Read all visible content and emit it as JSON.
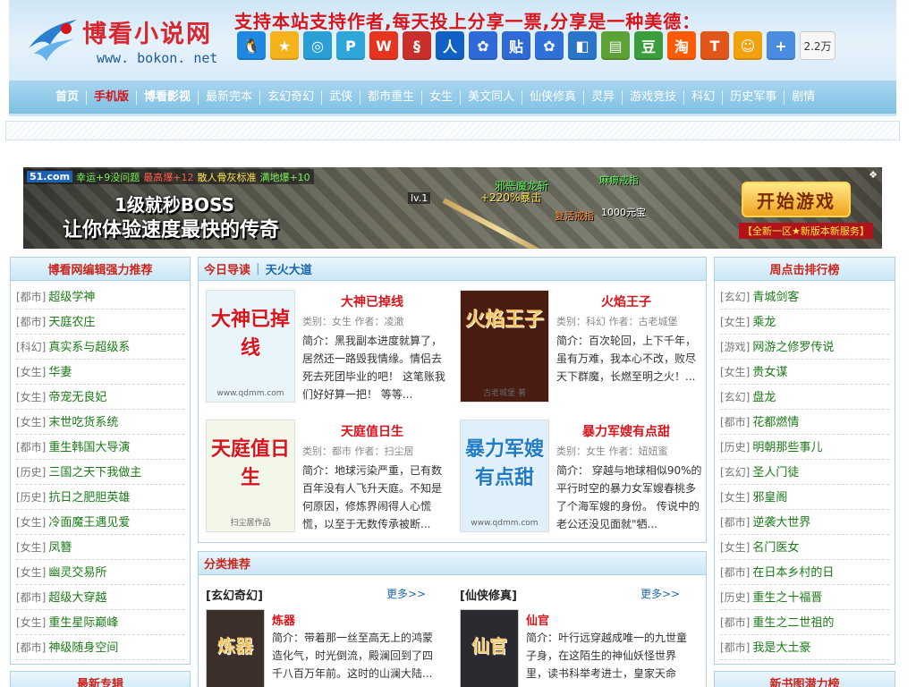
{
  "header": {
    "logo_title": "博看小说网",
    "logo_url": "www. bokon. net",
    "slogan": "支持本站支持作者,每天投上分享一票,分享是一种美德：",
    "share_count": "2.2万",
    "share_icons": [
      {
        "name": "qq",
        "glyph": "🐧",
        "color": "#1e88e5"
      },
      {
        "name": "qzone",
        "glyph": "★",
        "color": "#f6b21b"
      },
      {
        "name": "pengyou",
        "glyph": "◎",
        "color": "#2a9fd6"
      },
      {
        "name": "tencent-weibo",
        "glyph": "P",
        "color": "#2fa6d9"
      },
      {
        "name": "sina-weibo",
        "glyph": "W",
        "color": "#e8331f"
      },
      {
        "name": "netease",
        "glyph": "§",
        "color": "#c9302c"
      },
      {
        "name": "renren",
        "glyph": "人",
        "color": "#1160c4"
      },
      {
        "name": "baidu",
        "glyph": "✿",
        "color": "#2f6ad8"
      },
      {
        "name": "tieba",
        "glyph": "贴",
        "color": "#2f6ad8"
      },
      {
        "name": "baidu-paw",
        "glyph": "✿",
        "color": "#3070d8"
      },
      {
        "name": "kaixin",
        "glyph": "◧",
        "color": "#2a75c9"
      },
      {
        "name": "android",
        "glyph": "▤",
        "color": "#5da236"
      },
      {
        "name": "douban",
        "glyph": "豆",
        "color": "#3c9d3c"
      },
      {
        "name": "taobao",
        "glyph": "淘",
        "color": "#ff5a00"
      },
      {
        "name": "tianya",
        "glyph": "T",
        "color": "#e2561a"
      },
      {
        "name": "favorite",
        "glyph": "☺",
        "color": "#f2a20c"
      },
      {
        "name": "more",
        "glyph": "+",
        "color": "#4a8de0"
      }
    ]
  },
  "nav": [
    {
      "label": "首页",
      "style": "bold"
    },
    {
      "label": "手机版",
      "style": "red"
    },
    {
      "label": "博看影视",
      "style": "bold"
    },
    {
      "label": "最新完本",
      "style": ""
    },
    {
      "label": "玄幻奇幻",
      "style": ""
    },
    {
      "label": "武侠",
      "style": ""
    },
    {
      "label": "都市重生",
      "style": ""
    },
    {
      "label": "女生",
      "style": ""
    },
    {
      "label": "美文同人",
      "style": ""
    },
    {
      "label": "仙侠修真",
      "style": ""
    },
    {
      "label": "灵异",
      "style": ""
    },
    {
      "label": "游戏竞技",
      "style": ""
    },
    {
      "label": "科幻",
      "style": ""
    },
    {
      "label": "历史军事",
      "style": ""
    },
    {
      "label": "剧情",
      "style": ""
    }
  ],
  "banner": {
    "badge": "51.com",
    "topline": [
      "幸运+9没问题",
      "最高爆+12",
      "散人骨灰标准",
      "满地爆+10"
    ],
    "line1": "1级就秒BOSS",
    "line2": "让你体验速度最快的传奇",
    "level": "lv.1",
    "drop1": "邪恶魔龙斩",
    "drop2": "+220%暴击",
    "drop3": "麻痹戒指",
    "drop4": "复活戒指",
    "drop5": "1000元宝",
    "cta": "开始游戏",
    "sub": "【全新一区★新版本新服务】"
  },
  "left": {
    "title": "博看网编辑强力推荐",
    "items": [
      {
        "tag": "[都市]",
        "title": "超级学神"
      },
      {
        "tag": "[都市]",
        "title": "天庭农庄"
      },
      {
        "tag": "[科幻]",
        "title": "真实系与超级系"
      },
      {
        "tag": "[女生]",
        "title": "华妻"
      },
      {
        "tag": "[女生]",
        "title": "帝宠无良妃"
      },
      {
        "tag": "[女生]",
        "title": "末世吃货系统"
      },
      {
        "tag": "[都市]",
        "title": "重生韩国大导演"
      },
      {
        "tag": "[历史]",
        "title": "三国之天下我做主"
      },
      {
        "tag": "[历史]",
        "title": "抗日之肥胆英雄"
      },
      {
        "tag": "[女生]",
        "title": "冷面魔王遇见爱"
      },
      {
        "tag": "[女生]",
        "title": "凤簪"
      },
      {
        "tag": "[女生]",
        "title": "幽灵交易所"
      },
      {
        "tag": "[都市]",
        "title": "超级大穿越"
      },
      {
        "tag": "[女生]",
        "title": "重生星际巅峰"
      },
      {
        "tag": "[都市]",
        "title": "神级随身空间"
      }
    ],
    "next_title": "最新专辑"
  },
  "right": {
    "title": "周点击排行榜",
    "items": [
      {
        "tag": "[玄幻]",
        "title": "青城剑客"
      },
      {
        "tag": "[女生]",
        "title": "乘龙"
      },
      {
        "tag": "[游戏]",
        "title": "网游之修罗传说"
      },
      {
        "tag": "[女生]",
        "title": "贵女谋"
      },
      {
        "tag": "[玄幻]",
        "title": "盘龙"
      },
      {
        "tag": "[都市]",
        "title": "花都燃情"
      },
      {
        "tag": "[历史]",
        "title": "明朝那些事儿"
      },
      {
        "tag": "[玄幻]",
        "title": "圣人门徒"
      },
      {
        "tag": "[女生]",
        "title": "邪皇阁"
      },
      {
        "tag": "[都市]",
        "title": "逆袭大世界"
      },
      {
        "tag": "[女生]",
        "title": "名门医女"
      },
      {
        "tag": "[都市]",
        "title": "在日本乡村的日"
      },
      {
        "tag": "[历史]",
        "title": "重生之十福晋"
      },
      {
        "tag": "[都市]",
        "title": "重生之二世祖的"
      },
      {
        "tag": "[都市]",
        "title": "我是大土豪"
      }
    ],
    "next_title": "新书图潜力榜"
  },
  "today": {
    "tab1": "今日导读",
    "sep": "|",
    "tab2": "天火大道",
    "books": [
      {
        "name": "大神已掉线",
        "meta": "类别：女生 作者：凌澈",
        "intro": "简介：黑我副本进度就算了，居然还一路毁我情缘。情侣去死去死团毕业的吧！ 这笔账我们好好算一把！ 等等...",
        "cover_text": "大神已掉线",
        "cover_bg": "#e9f4fb",
        "cover_color": "#d6151c",
        "site": "www.qdmm.com"
      },
      {
        "name": "火焰王子",
        "meta": "类别：科幻 作者：古老城堡",
        "intro": "简介：百次轮回，上下千年，虽有万难，我本心不改，败尽天下群魔，长燃至明之火！...",
        "cover_text": "火焰王子",
        "cover_bg": "#4a1d12",
        "cover_color": "#f6c35a",
        "site": "古老城堡 著"
      },
      {
        "name": "天庭值日生",
        "meta": "类别：都市 作者：扫尘居",
        "intro": "简介：地球污染严重，已有数百年没有人飞升天庭。不知是何原因，修炼界闹得人心慌慌，以至于无数传承被断...",
        "cover_text": "天庭值日生",
        "cover_bg": "#f3f7e9",
        "cover_color": "#d6151c",
        "site": "扫尘居作品"
      },
      {
        "name": "暴力军嫂有点甜",
        "meta": "类别：女生 作者：妞妞蜜",
        "intro": "简介： 穿越与地球相似90%的平行时空的暴力女军嫂春桃多了个海军嫂的身份。 传说中的老公还没见面就\"牺...",
        "cover_text": "暴力军嫂有点甜",
        "cover_bg": "#dff0fb",
        "cover_color": "#1f7bc6",
        "site": "www.qdmm.com"
      }
    ]
  },
  "category": {
    "title": "分类推荐",
    "cols": [
      {
        "name": "[玄幻奇幻]",
        "more": "更多>>",
        "book": "炼器",
        "intro": "简介：带着那一丝至高无上的鸿蒙造化气，时光倒流，殿澜回到了四千八百万年前。这时的山澜大陆...",
        "cover_text": "炼器",
        "cover_bg": "#3a2f2a"
      },
      {
        "name": "[仙侠修真]",
        "more": "更多>>",
        "book": "仙官",
        "intro": "简介：叶行远穿越成唯一的九世童子身，在这陌生的神仙妖怪世界里，读书科举考进士，皇家天命得...",
        "cover_text": "仙官",
        "cover_bg": "#2a2a30"
      }
    ]
  }
}
